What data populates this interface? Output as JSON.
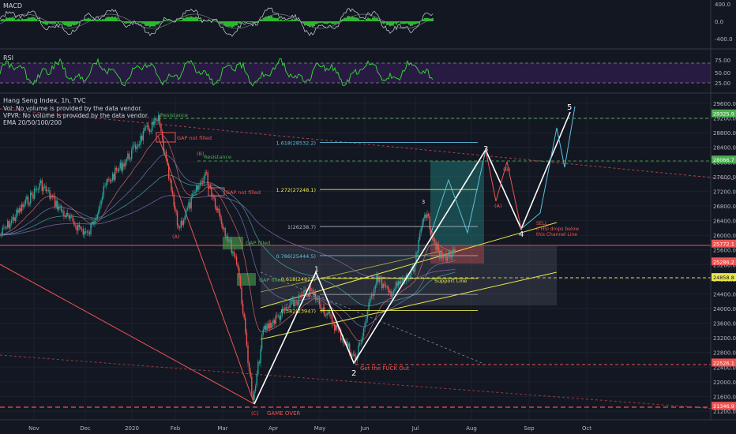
{
  "panels": {
    "macd": {
      "label": "MACD",
      "ticks": [
        "400.0",
        "0.0",
        "-400.0"
      ]
    },
    "rsi": {
      "label": "RSI",
      "ticks": [
        "75.00",
        "50.00",
        "25.00"
      ]
    }
  },
  "legend": {
    "title": "Hang Seng Index, 1h, TVC",
    "lines": [
      "Vol: No volume is provided by the data vendor.",
      "VPVR: No volume is provided by the data vendor.",
      "EMA 20/50/100/200"
    ]
  },
  "colors": {
    "background": "#131722",
    "candle_up": "#26a69a",
    "candle_down": "#ef5350",
    "wave_line": "#ffffff",
    "channel": "#e8e64a",
    "macd_hist": "#33e033",
    "rsi_line": "#33e033",
    "fib": "#5bc0de",
    "resistance": "#4caf50"
  },
  "chart_data": {
    "type": "line",
    "title": "Hang Seng Index, 1h, TVC",
    "xlabel": "",
    "ylabel": "",
    "x_ticks": [
      "Nov",
      "Dec",
      "2020",
      "Feb",
      "Mar",
      "Apr",
      "May",
      "Jun",
      "Jul",
      "Aug",
      "Sep",
      "Oct"
    ],
    "y_ticks": [
      21200,
      21600,
      22000,
      22400,
      22800,
      23200,
      23600,
      24000,
      24400,
      24800,
      25200,
      25600,
      26000,
      26400,
      26800,
      27200,
      27600,
      28000,
      28400,
      28800,
      29200,
      29600
    ],
    "ylim": [
      21100,
      29800
    ],
    "grid": true,
    "series": [
      {
        "points": [
          [
            "Oct 25",
            26000
          ],
          [
            "Nov 5",
            27400
          ],
          [
            "Nov 20",
            26500
          ],
          [
            "Dec 3",
            26000
          ],
          [
            "Dec 15",
            27400
          ],
          [
            "Dec 31",
            28200
          ],
          [
            "Jan 10",
            28800
          ],
          [
            "Jan 20",
            29150
          ],
          [
            "Jan 31",
            26800
          ],
          [
            "Feb 3",
            26200
          ],
          [
            "Feb 20",
            27700
          ],
          [
            "Mar 1",
            26300
          ],
          [
            "Mar 10",
            25200
          ],
          [
            "Mar 19",
            21400
          ],
          [
            "Mar 25",
            23400
          ],
          [
            "Apr 10",
            24000
          ],
          [
            "Apr 25",
            24500
          ],
          [
            "May 10",
            23600
          ],
          [
            "May 25",
            22600
          ],
          [
            "Jun 8",
            24900
          ],
          [
            "Jun 15",
            24400
          ],
          [
            "Jun 30",
            25000
          ],
          [
            "Jul 6",
            26700
          ],
          [
            "Jul 14",
            25400
          ],
          [
            "Jul 23",
            25500
          ]
        ]
      }
    ],
    "price_levels": [
      {
        "label": "29325.9",
        "value": 29325.9
      },
      {
        "label": "28066.7",
        "value": 28066.7
      },
      {
        "label": "25772.1",
        "value": 25772.1
      },
      {
        "label": "25286.2",
        "value": 25286.2
      },
      {
        "label": "24858.8",
        "value": 24858.8
      },
      {
        "label": "22526.1",
        "value": 22526.1
      },
      {
        "label": "21346.9",
        "value": 21346.9
      }
    ],
    "fib_levels": [
      {
        "label": "1.618(28532.2)",
        "value": 28532.2
      },
      {
        "label": "1.272(27248.1)",
        "value": 27248.1
      },
      {
        "label": "1(26238.7)",
        "value": 26238.7
      },
      {
        "label": "0.786(25444.5)",
        "value": 25444.5
      },
      {
        "label": "0.618(24822)",
        "value": 24822
      },
      {
        "label": "0.5",
        "value": 24385
      },
      {
        "label": "0.382(23947)",
        "value": 23947
      }
    ],
    "annotations": {
      "gap1": "GAP not filled",
      "gap2": "GAP not filled",
      "gap3": "GAP filled",
      "gap4": "GAP filled",
      "resistance1": "Resistance",
      "resistance2": "Resistance",
      "support": "Support Line",
      "sell": [
        "SELL",
        "If HSI drops below",
        "this Channel Line"
      ],
      "getout": "Get the FUCK Out",
      "gameover": "GAME OVER",
      "waveA1": "(A)",
      "waveB1": "(B)",
      "waveA2": "(A)",
      "waveC1": "(C)",
      "wave1": "1",
      "wave2": "2",
      "wave3": "3",
      "wave4": "4",
      "wave5": "5",
      "waveApr": "(A)",
      "waveBpr": "(B)"
    }
  }
}
